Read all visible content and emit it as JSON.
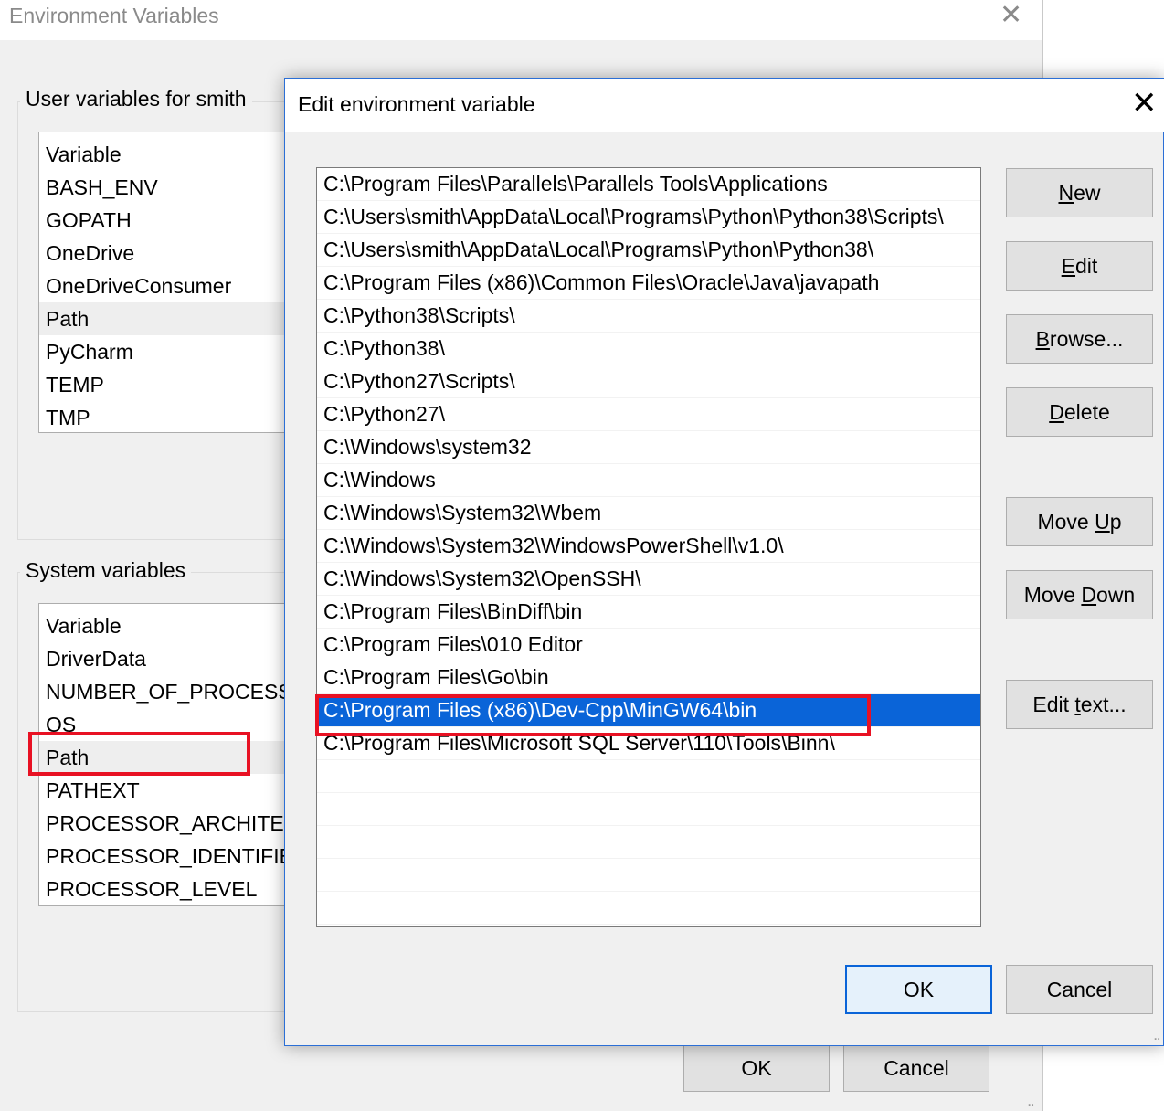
{
  "background_window": {
    "title": "Environment Variables",
    "user_group_title": "User variables for smith",
    "user_variables": [
      "Variable",
      "BASH_ENV",
      "GOPATH",
      "OneDrive",
      "OneDriveConsumer",
      "Path",
      "PyCharm",
      "TEMP",
      "TMP"
    ],
    "user_selected": "Path",
    "system_group_title": "System variables",
    "system_variables": [
      "Variable",
      "DriverData",
      "NUMBER_OF_PROCESSO",
      "OS",
      "Path",
      "PATHEXT",
      "PROCESSOR_ARCHITECTU",
      "PROCESSOR_IDENTIFIER",
      "PROCESSOR_LEVEL"
    ],
    "system_selected": "Path",
    "ok_label": "OK",
    "cancel_label": "Cancel"
  },
  "dialog": {
    "title": "Edit environment variable",
    "paths": [
      "C:\\Program Files\\Parallels\\Parallels Tools\\Applications",
      "C:\\Users\\smith\\AppData\\Local\\Programs\\Python\\Python38\\Scripts\\",
      "C:\\Users\\smith\\AppData\\Local\\Programs\\Python\\Python38\\",
      "C:\\Program Files (x86)\\Common Files\\Oracle\\Java\\javapath",
      "C:\\Python38\\Scripts\\",
      "C:\\Python38\\",
      "C:\\Python27\\Scripts\\",
      "C:\\Python27\\",
      "C:\\Windows\\system32",
      "C:\\Windows",
      "C:\\Windows\\System32\\Wbem",
      "C:\\Windows\\System32\\WindowsPowerShell\\v1.0\\",
      "C:\\Windows\\System32\\OpenSSH\\",
      "C:\\Program Files\\BinDiff\\bin",
      "C:\\Program Files\\010 Editor",
      "C:\\Program Files\\Go\\bin",
      "C:\\Program Files (x86)\\Dev-Cpp\\MinGW64\\bin",
      "C:\\Program Files\\Microsoft SQL Server\\110\\Tools\\Binn\\"
    ],
    "selected_index": 16,
    "empty_rows": 5,
    "buttons": {
      "new": "New",
      "edit": "Edit",
      "browse": "Browse...",
      "delete": "Delete",
      "move_up": "Move Up",
      "move_down": "Move Down",
      "edit_text": "Edit text..."
    },
    "ok_label": "OK",
    "cancel_label": "Cancel"
  },
  "colors": {
    "selection": "#0a64d8",
    "annotation_red": "#e81123"
  }
}
